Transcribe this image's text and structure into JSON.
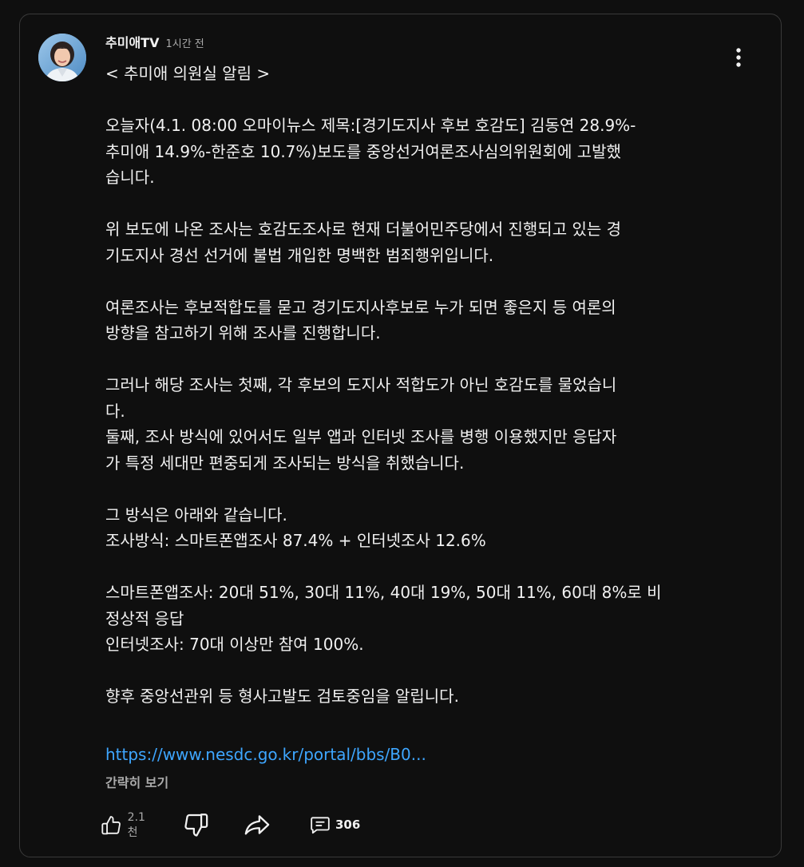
{
  "post": {
    "channel_name": "추미애TV",
    "time": "1시간 전",
    "paragraphs": [
      "< 추미애 의원실 알림 >",
      "",
      "오늘자(4.1. 08:00 오마이뉴스 제목:[경기도지사 후보 호감도] 김동연 28.9%-\n추미애 14.9%-한준호 10.7%)보도를 중앙선거여론조사심의위원회에 고발했\n습니다.",
      "",
      "위 보도에 나온 조사는 호감도조사로 현재 더불어민주당에서 진행되고 있는 경\n기도지사 경선 선거에 불법 개입한 명백한 범죄행위입니다.",
      "",
      "여론조사는 후보적합도를 묻고 경기도지사후보로 누가 되면 좋은지 등 여론의\n방향을 참고하기 위해 조사를 진행합니다.",
      "",
      "그러나 해당 조사는 첫째, 각 후보의 도지사 적합도가 아닌 호감도를 물었습니\n다.\n둘째, 조사 방식에 있어서도 일부 앱과 인터넷 조사를 병행 이용했지만 응답자\n가 특정 세대만 편중되게 조사되는 방식을 취했습니다.",
      "",
      "그 방식은 아래와 같습니다.\n조사방식: 스마트폰앱조사 87.4% + 인터넷조사 12.6%",
      "",
      "스마트폰앱조사: 20대 51%, 30대 11%, 40대 19%, 50대 11%, 60대 8%로 비\n정상적 응답\n인터넷조사: 70대 이상만 참여 100%.",
      "",
      "향후 중앙선관위 등 형사고발도 검토중임을 알립니다."
    ],
    "link_text": "https://www.nesdc.go.kr/portal/bbs/B0...",
    "collapse_label": "간략히 보기"
  },
  "actions": {
    "like_count": "2.1천",
    "comment_count": "306"
  },
  "colors": {
    "background": "#0f0f0f",
    "text": "#f1f1f1",
    "muted": "#aaaaaa",
    "link": "#3ea6ff",
    "border": "#3a3a3a"
  }
}
